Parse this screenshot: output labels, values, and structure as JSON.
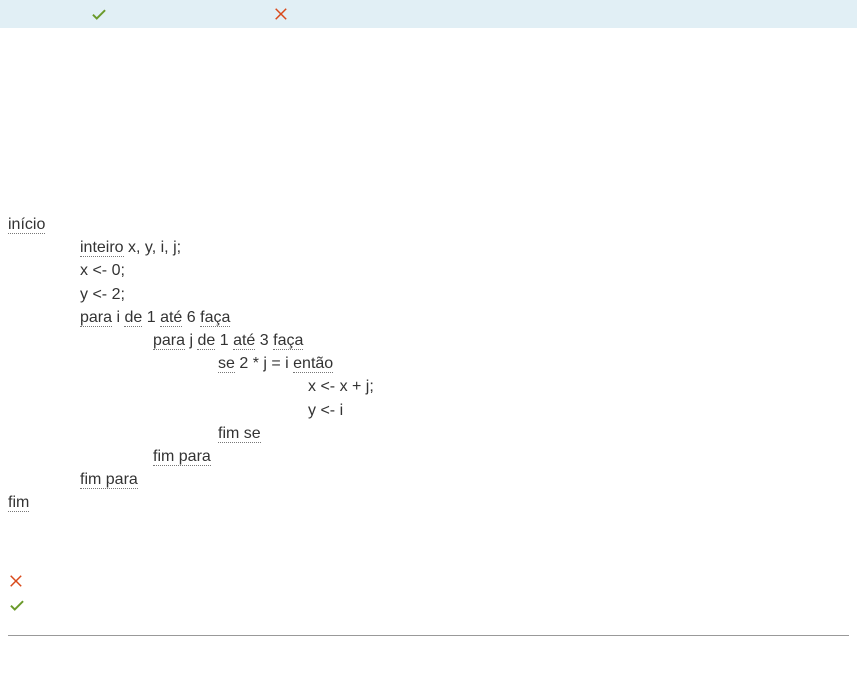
{
  "icons": {
    "check": "check-icon",
    "cross": "cross-icon"
  },
  "code": {
    "inicio": "início",
    "inteiro": "inteiro",
    "vars": " x, y, i, j;",
    "l3": "x <- 0;",
    "l4": "y <- 2;",
    "para": "para",
    "de": "de",
    "ate": "até",
    "faca": "faça",
    "outer_i": " i ",
    "outer_1": " 1 ",
    "outer_6": " 6 ",
    "inner_j": " j ",
    "inner_1": " 1 ",
    "inner_3": " 3 ",
    "se": "se",
    "cond": " 2 * j = i ",
    "entao": "então",
    "assign1": "x <- x + j;",
    "assign2": "y <- i",
    "fimse": "fim se",
    "fimpara": "fim para",
    "fim": "fim"
  }
}
